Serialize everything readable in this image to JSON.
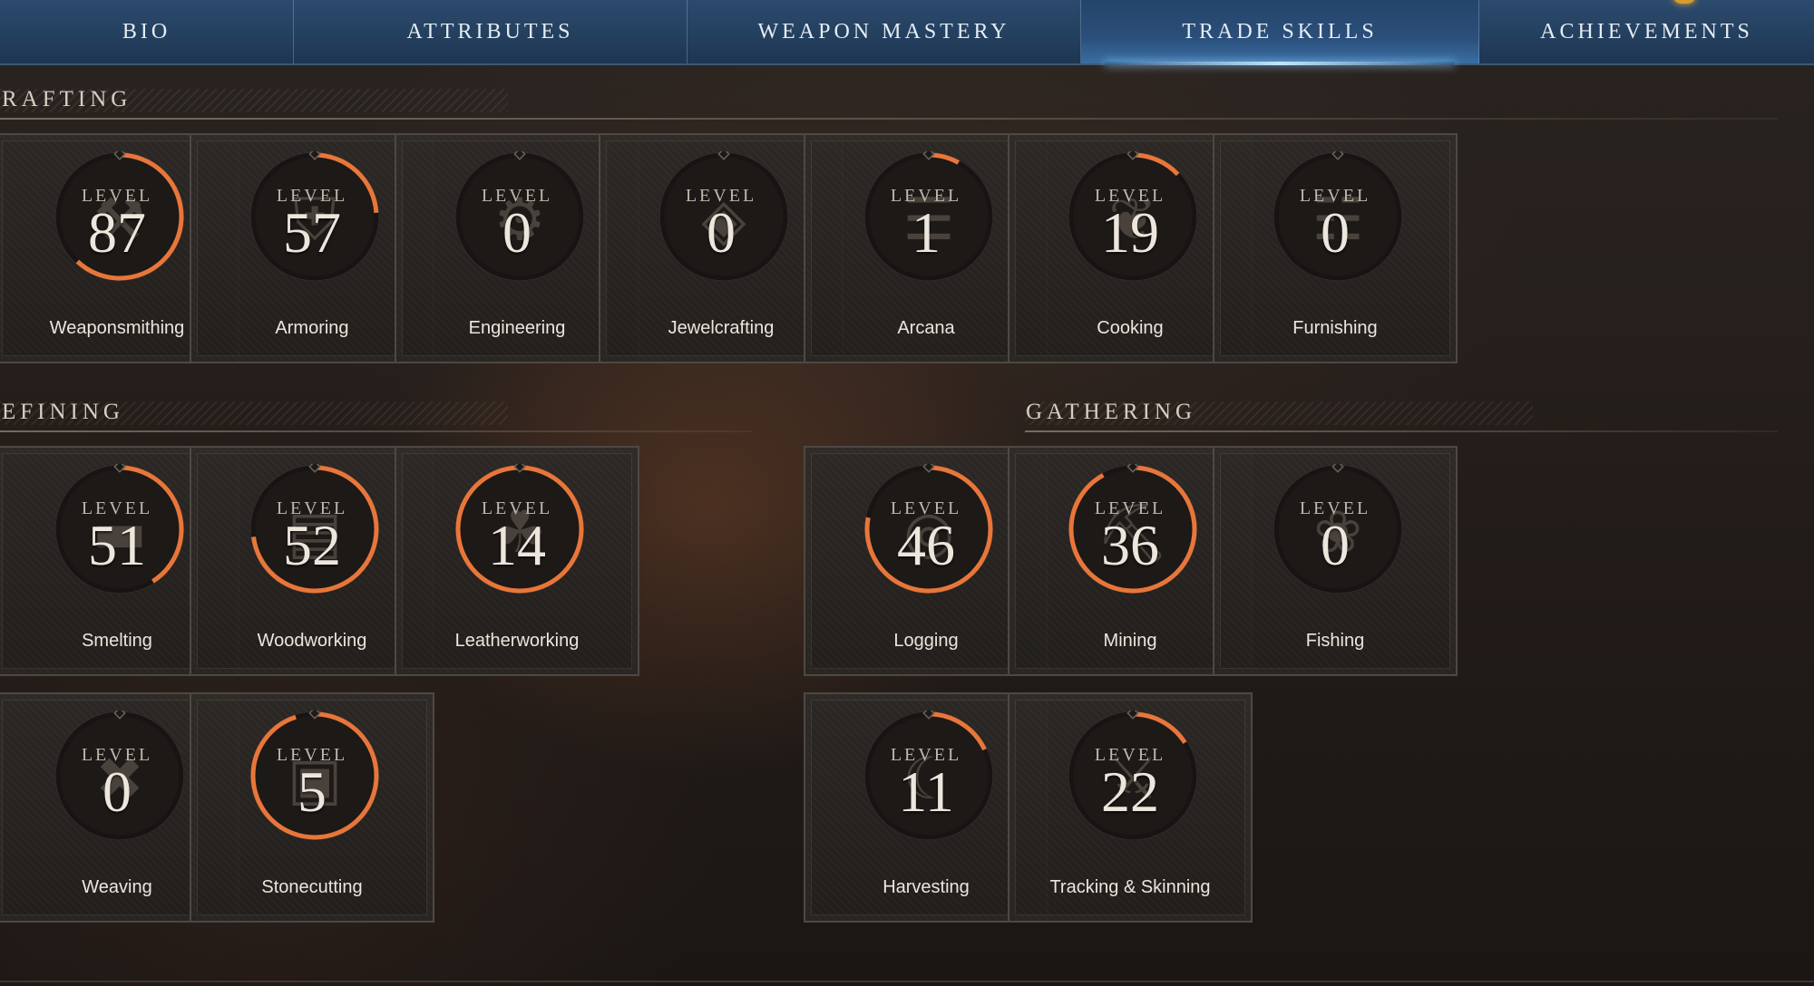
{
  "nav": {
    "tabs": [
      {
        "label": "BIO",
        "active": false
      },
      {
        "label": "ATTRIBUTES",
        "active": false
      },
      {
        "label": "WEAPON MASTERY",
        "active": false
      },
      {
        "label": "TRADE SKILLS",
        "active": true
      },
      {
        "label": "ACHIEVEMENTS",
        "active": false
      }
    ]
  },
  "colors": {
    "progress_ring": "#e8763a",
    "ring_track": "#171413",
    "nav_bg": "#24405f",
    "active_tab_glow": "#bfe6ff"
  },
  "level_caption": "LEVEL",
  "sections": {
    "crafting": {
      "title": "RAFTING",
      "skills": [
        {
          "name": "Weaponsmithing",
          "level": "87",
          "progress": 0.62,
          "icon": "anvil-icon"
        },
        {
          "name": "Armoring",
          "level": "57",
          "progress": 0.24,
          "icon": "chestplate-icon"
        },
        {
          "name": "Engineering",
          "level": "0",
          "progress": 0,
          "icon": "gear-icon"
        },
        {
          "name": "Jewelcrafting",
          "level": "0",
          "progress": 0,
          "icon": "gem-icon"
        },
        {
          "name": "Arcana",
          "level": "1",
          "progress": 0.08,
          "icon": "spellbook-icon"
        },
        {
          "name": "Cooking",
          "level": "19",
          "progress": 0.13,
          "icon": "laurel-icon"
        },
        {
          "name": "Furnishing",
          "level": "0",
          "progress": 0,
          "icon": "chair-icon"
        }
      ]
    },
    "refining": {
      "title": "EFINING",
      "skills": [
        {
          "name": "Smelting",
          "level": "51",
          "progress": 0.41,
          "icon": "ingot-icon"
        },
        {
          "name": "Woodworking",
          "level": "52",
          "progress": 0.73,
          "icon": "plank-icon"
        },
        {
          "name": "Leatherworking",
          "level": "14",
          "progress": 1.0,
          "icon": "hide-icon"
        },
        {
          "name": "Weaving",
          "level": "0",
          "progress": 0,
          "icon": "weave-icon"
        },
        {
          "name": "Stonecutting",
          "level": "5",
          "progress": 0.95,
          "icon": "stone-block-icon"
        }
      ]
    },
    "gathering": {
      "title": "GATHERING",
      "skills": [
        {
          "name": "Logging",
          "level": "46",
          "progress": 0.78,
          "icon": "log-icon"
        },
        {
          "name": "Mining",
          "level": "36",
          "progress": 0.92,
          "icon": "pickaxe-icon"
        },
        {
          "name": "Fishing",
          "level": "0",
          "progress": 0,
          "icon": "fish-icon"
        },
        {
          "name": "Harvesting",
          "level": "11",
          "progress": 0.18,
          "icon": "sickle-icon"
        },
        {
          "name": "Tracking & Skinning",
          "level": "22",
          "progress": 0.16,
          "icon": "skinning-knife-icon"
        }
      ]
    }
  }
}
